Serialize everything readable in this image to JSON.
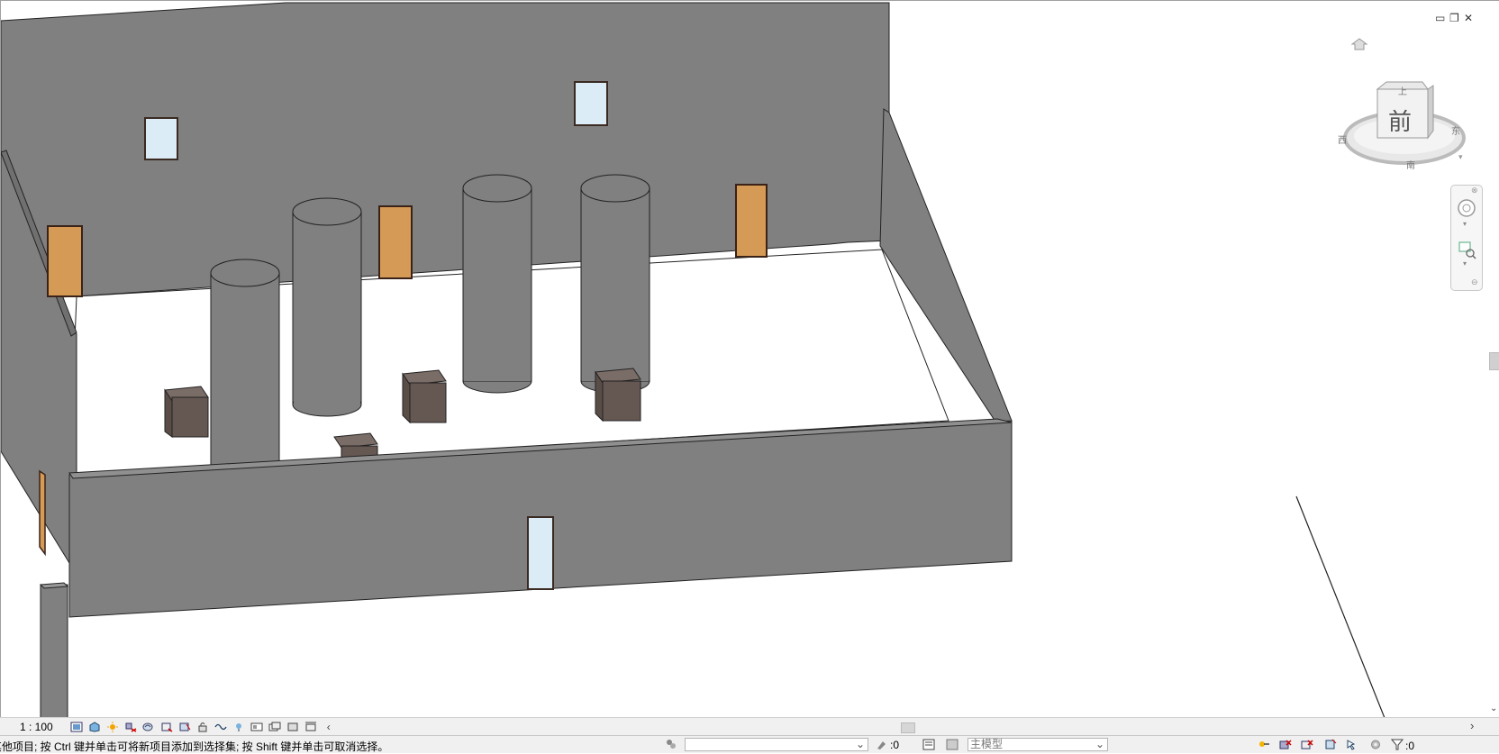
{
  "view": {
    "scale_label": "1 : 100",
    "viewcube_face": "前",
    "viewcube_top": "上",
    "viewcube_left_label": "西",
    "viewcube_right_label": "东",
    "viewcube_bottom_label": "南"
  },
  "window_controls": {
    "minimize": "▭",
    "restore": "❐",
    "close": "✕"
  },
  "status": {
    "message": "其他项目; 按 Ctrl 键并单击可将新项目添加到选择集; 按 Shift 键并单击可取消选择。",
    "workset_count": ":0",
    "model_field": "主模型",
    "filter_count": ":0"
  },
  "icons": [
    "home-icon",
    "viewcube-icon",
    "steering-wheel-icon",
    "zoom-icon",
    "visual-style-icon",
    "shadows-icon",
    "sun-path-icon",
    "render-icon",
    "crop-icon",
    "hide-isolate-icon",
    "reveal-hidden-icon",
    "filter-icon",
    "workset-icon",
    "design-option-icon"
  ],
  "colors": {
    "wall": "#808080",
    "floor": "#ffffff",
    "door": "#d59b56",
    "window_glass": "#dcecf6",
    "box": "#655752"
  }
}
